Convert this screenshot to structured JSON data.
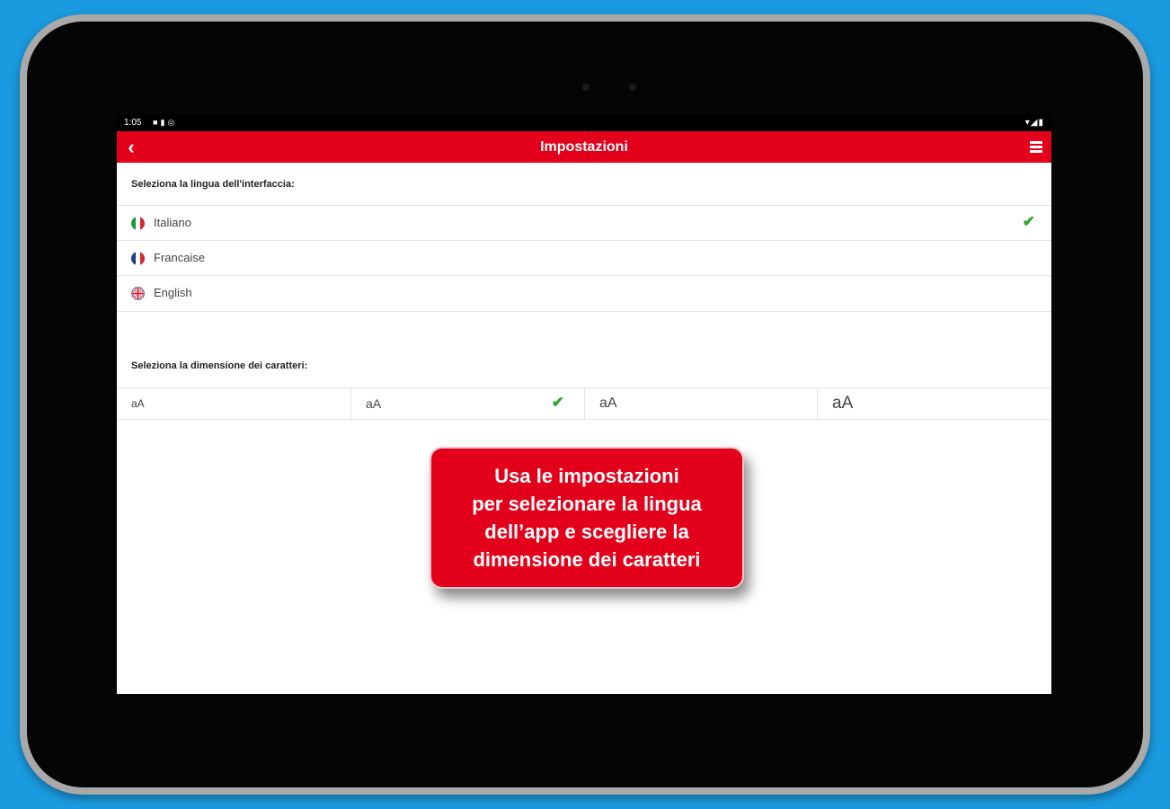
{
  "status_bar": {
    "time": "1:05",
    "left_icons": [
      "notification-icon",
      "sim-icon",
      "sync-icon"
    ],
    "right_icons": [
      "wifi-icon",
      "signal-icon",
      "battery-icon"
    ]
  },
  "app_bar": {
    "back_icon": "chevron-left-icon",
    "title": "Impostazioni",
    "menu_icon": "hamburger-menu-icon"
  },
  "language_section": {
    "label": "Seleziona la lingua dell'interfaccia:",
    "items": [
      {
        "label": "Italiano",
        "flag": "italy-flag-icon",
        "selected": true
      },
      {
        "label": "Francaise",
        "flag": "france-flag-icon",
        "selected": false
      },
      {
        "label": "English",
        "flag": "uk-flag-icon",
        "selected": false
      }
    ]
  },
  "font_size_section": {
    "label": "Seleziona la dimensione dei caratteri:",
    "options": [
      {
        "label": "aA",
        "selected": false
      },
      {
        "label": "aA",
        "selected": true
      },
      {
        "label": "aA",
        "selected": false
      },
      {
        "label": "aA",
        "selected": false
      }
    ]
  },
  "callout": {
    "lines": [
      "Usa le impostazioni",
      "per selezionare la lingua",
      "dell’app e scegliere la",
      "dimensione dei caratteri"
    ]
  },
  "nav_bar": {
    "back_icon": "triangle-back-icon",
    "home_icon": "circle-home-icon",
    "recents_icon": "square-recents-icon"
  },
  "colors": {
    "accent": "#e2001a",
    "check": "#2ea62e",
    "background": "#1a9be0"
  }
}
